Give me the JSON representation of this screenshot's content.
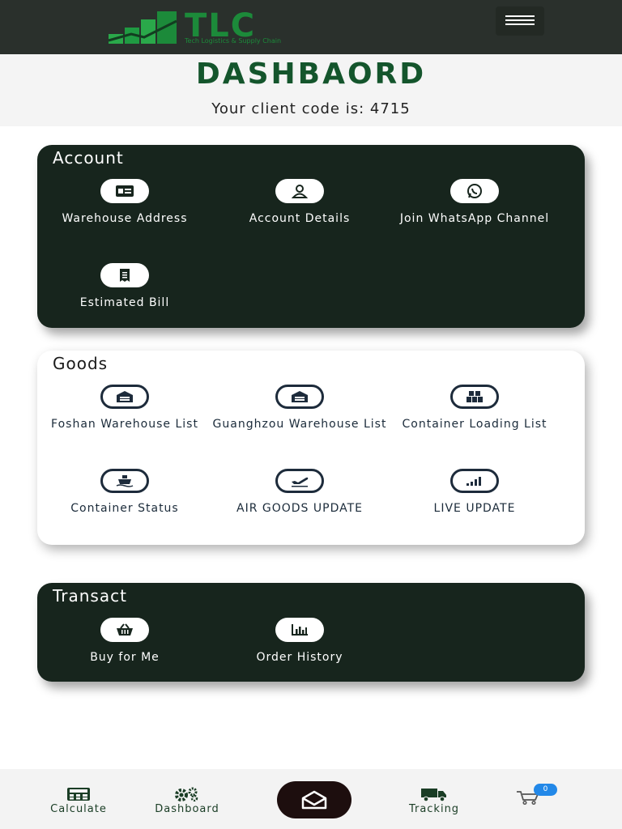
{
  "brand": {
    "logo_text": "TLC",
    "tagline": "Tech Logistics & Supply Chain"
  },
  "header": {
    "title": "DASHBAORD",
    "client_code_text": "Your client code is: 4715"
  },
  "account": {
    "title": "Account",
    "items": [
      {
        "label": "Warehouse Address",
        "icon": "address-card-icon"
      },
      {
        "label": "Account Details",
        "icon": "user-icon"
      },
      {
        "label": "Join WhatsApp Channel",
        "icon": "whatsapp-icon"
      },
      {
        "label": "Estimated Bill",
        "icon": "receipt-icon"
      }
    ]
  },
  "goods": {
    "title": "Goods",
    "items": [
      {
        "label": "Foshan Warehouse List",
        "icon": "warehouse-icon"
      },
      {
        "label": "Guanghzou Warehouse List",
        "icon": "warehouse-icon"
      },
      {
        "label": "Container Loading List",
        "icon": "boxes-icon"
      },
      {
        "label": "Container Status",
        "icon": "ship-icon"
      },
      {
        "label": "AIR GOODS UPDATE",
        "icon": "plane-departure-icon"
      },
      {
        "label": "LIVE UPDATE",
        "icon": "signal-bars-icon"
      }
    ]
  },
  "transact": {
    "title": "Transact",
    "items": [
      {
        "label": "Buy for Me",
        "icon": "basket-icon"
      },
      {
        "label": "Order History",
        "icon": "chart-icon"
      }
    ]
  },
  "bottom_nav": {
    "calculate": "Calculate",
    "dashboard": "Dashboard",
    "tracking": "Tracking",
    "cart_count": "0"
  },
  "colors": {
    "topbar": "#2a302c",
    "brand_green": "#1c8a3a",
    "title_green": "#14552c",
    "card_dark": "#17251d",
    "icon_navy": "#1d2b3b",
    "badge_blue": "#2288e8"
  }
}
